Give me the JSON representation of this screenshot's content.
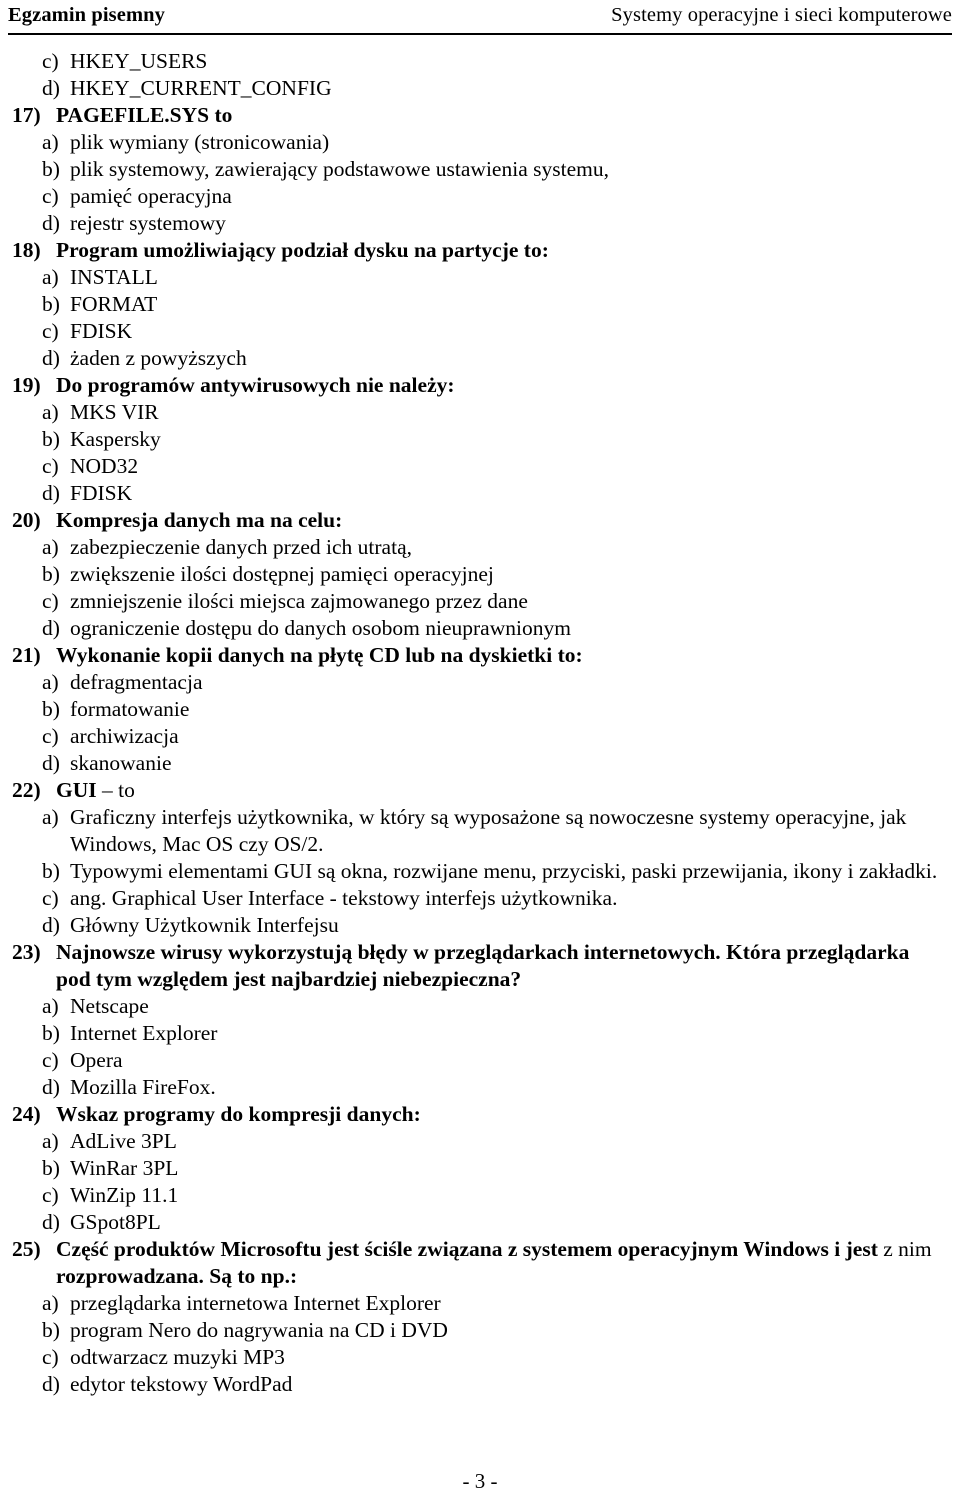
{
  "header": {
    "left": "Egzamin pisemny",
    "right": "Systemy operacyjne i sieci komputerowe"
  },
  "footer": {
    "page_label": "- 3 -"
  },
  "items": [
    {
      "kind": "answer",
      "marker": "c)",
      "text": "HKEY_USERS"
    },
    {
      "kind": "answer",
      "marker": "d)",
      "text": "HKEY_CURRENT_CONFIG"
    },
    {
      "kind": "question",
      "marker": "17)",
      "text": "PAGEFILE.SYS to"
    },
    {
      "kind": "answer",
      "marker": "a)",
      "text": "plik wymiany (stronicowania)"
    },
    {
      "kind": "answer",
      "marker": "b)",
      "text": "plik systemowy, zawierający podstawowe ustawienia systemu,"
    },
    {
      "kind": "answer",
      "marker": "c)",
      "text": "pamięć operacyjna"
    },
    {
      "kind": "answer",
      "marker": "d)",
      "text": "rejestr systemowy"
    },
    {
      "kind": "question",
      "marker": "18)",
      "text": "Program umożliwiający podział dysku na partycje to:"
    },
    {
      "kind": "answer",
      "marker": "a)",
      "text": "INSTALL"
    },
    {
      "kind": "answer",
      "marker": "b)",
      "text": "FORMAT"
    },
    {
      "kind": "answer",
      "marker": "c)",
      "text": "FDISK"
    },
    {
      "kind": "answer",
      "marker": "d)",
      "text": "żaden z powyższych"
    },
    {
      "kind": "question",
      "marker": "19)",
      "text": "Do programów antywirusowych nie należy:"
    },
    {
      "kind": "answer",
      "marker": "a)",
      "text": "MKS VIR"
    },
    {
      "kind": "answer",
      "marker": "b)",
      "text": "Kaspersky"
    },
    {
      "kind": "answer",
      "marker": "c)",
      "text": "NOD32"
    },
    {
      "kind": "answer",
      "marker": "d)",
      "text": "FDISK"
    },
    {
      "kind": "question",
      "marker": "20)",
      "text": "Kompresja danych ma na celu:"
    },
    {
      "kind": "answer",
      "marker": "a)",
      "text": "zabezpieczenie danych przed ich utratą,"
    },
    {
      "kind": "answer",
      "marker": "b)",
      "text": "zwiększenie ilości dostępnej pamięci operacyjnej"
    },
    {
      "kind": "answer",
      "marker": "c)",
      "text": "zmniejszenie ilości miejsca zajmowanego przez dane"
    },
    {
      "kind": "answer",
      "marker": "d)",
      "text": "ograniczenie dostępu do danych osobom nieuprawnionym"
    },
    {
      "kind": "question",
      "marker": "21)",
      "text": "Wykonanie kopii danych na płytę CD lub na dyskietki to:"
    },
    {
      "kind": "answer",
      "marker": "a)",
      "text": "defragmentacja"
    },
    {
      "kind": "answer",
      "marker": "b)",
      "text": "formatowanie"
    },
    {
      "kind": "answer",
      "marker": "c)",
      "text": "archiwizacja"
    },
    {
      "kind": "answer",
      "marker": "d)",
      "text": "skanowanie"
    },
    {
      "kind": "question",
      "marker": "22)",
      "text": "GUI",
      "text_regular_tail": " – to"
    },
    {
      "kind": "answer",
      "marker": "a)",
      "text": "Graficzny interfejs użytkownika, w który są wyposażone są nowoczesne systemy operacyjne, jak Windows, Mac OS czy OS/2."
    },
    {
      "kind": "answer",
      "marker": "b)",
      "text": "Typowymi elementami GUI są okna, rozwijane menu, przyciski, paski przewijania, ikony i zakładki."
    },
    {
      "kind": "answer",
      "marker": "c)",
      "text": "ang. Graphical User Interface - tekstowy interfejs użytkownika."
    },
    {
      "kind": "answer",
      "marker": "d)",
      "text": "Główny Użytkownik Interfejsu"
    },
    {
      "kind": "question",
      "marker": "23)",
      "text": "Najnowsze wirusy wykorzystują błędy w przeglądarkach internetowych. Która przeglądarka pod tym względem jest najbardziej niebezpieczna?"
    },
    {
      "kind": "answer",
      "marker": "a)",
      "text": "Netscape"
    },
    {
      "kind": "answer",
      "marker": "b)",
      "text": "Internet Explorer"
    },
    {
      "kind": "answer",
      "marker": "c)",
      "text": "Opera"
    },
    {
      "kind": "answer",
      "marker": "d)",
      "text": "Mozilla FireFox."
    },
    {
      "kind": "question",
      "marker": "24)",
      "text": "Wskaz programy do kompresji danych:"
    },
    {
      "kind": "answer",
      "marker": "a)",
      "text": "AdLive 3PL"
    },
    {
      "kind": "answer",
      "marker": "b)",
      "text": "WinRar 3PL"
    },
    {
      "kind": "answer",
      "marker": "c)",
      "text": "WinZip 11.1"
    },
    {
      "kind": "answer",
      "marker": "d)",
      "text": "GSpot8PL"
    },
    {
      "kind": "question",
      "marker": "25)",
      "text": "Część produktów Microsoftu jest ściśle związana z systemem operacyjnym Windows i jest",
      "text_mid_regular": " z nim ",
      "text_bold_tail": "rozprowadzana. Są to np.:"
    },
    {
      "kind": "answer",
      "marker": "a)",
      "text": "przeglądarka internetowa Internet Explorer"
    },
    {
      "kind": "answer",
      "marker": "b)",
      "text": "program Nero do nagrywania na CD i DVD"
    },
    {
      "kind": "answer",
      "marker": "c)",
      "text": "odtwarzacz muzyki MP3"
    },
    {
      "kind": "answer",
      "marker": "d)",
      "text": "edytor tekstowy WordPad"
    }
  ]
}
